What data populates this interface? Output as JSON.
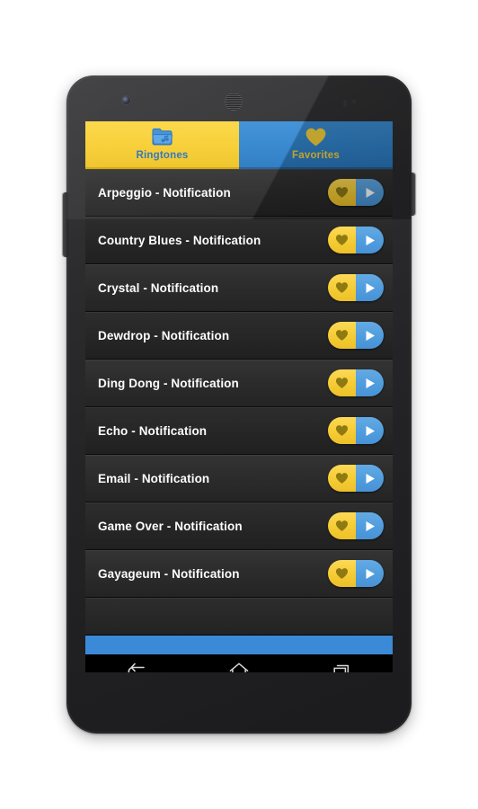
{
  "device": {
    "name": "android-smartphone",
    "front_camera": "camera-icon",
    "earpiece": "speaker-grille-icon",
    "sensors": "proximity-sensor-icon",
    "volume_button": "volume-rocker",
    "power_button": "power-button"
  },
  "tabs": [
    {
      "id": "ringtones",
      "label": "Ringtones",
      "icon": "folder-music-icon",
      "selected": true,
      "bg": "#f8cf32",
      "text_color": "#2b72bd"
    },
    {
      "id": "favorites",
      "label": "Favorites",
      "icon": "heart-icon",
      "selected": false,
      "bg": "#3286cf",
      "text_color": "#f6d23c"
    }
  ],
  "list": {
    "favorite_icon": "heart-icon",
    "play_icon": "play-icon",
    "items": [
      {
        "title": "Arpeggio - Notification"
      },
      {
        "title": "Country Blues - Notification"
      },
      {
        "title": "Crystal - Notification"
      },
      {
        "title": "Dewdrop - Notification"
      },
      {
        "title": "Ding Dong - Notification"
      },
      {
        "title": "Echo - Notification"
      },
      {
        "title": "Email - Notification"
      },
      {
        "title": "Game Over - Notification"
      },
      {
        "title": "Gayageum - Notification"
      }
    ]
  },
  "ad_banner": {
    "label": "",
    "color": "#3b8ad8"
  },
  "nav_bar": {
    "buttons": [
      {
        "id": "back",
        "icon": "back-arrow-icon"
      },
      {
        "id": "home",
        "icon": "home-icon"
      },
      {
        "id": "recents",
        "icon": "recent-apps-icon"
      }
    ]
  },
  "colors": {
    "accent_yellow": "#f8cf32",
    "accent_blue": "#3286cf",
    "heart_fill": "#8f7a12",
    "list_bg": "#2d2d2d",
    "text": "#fdfdfd"
  }
}
